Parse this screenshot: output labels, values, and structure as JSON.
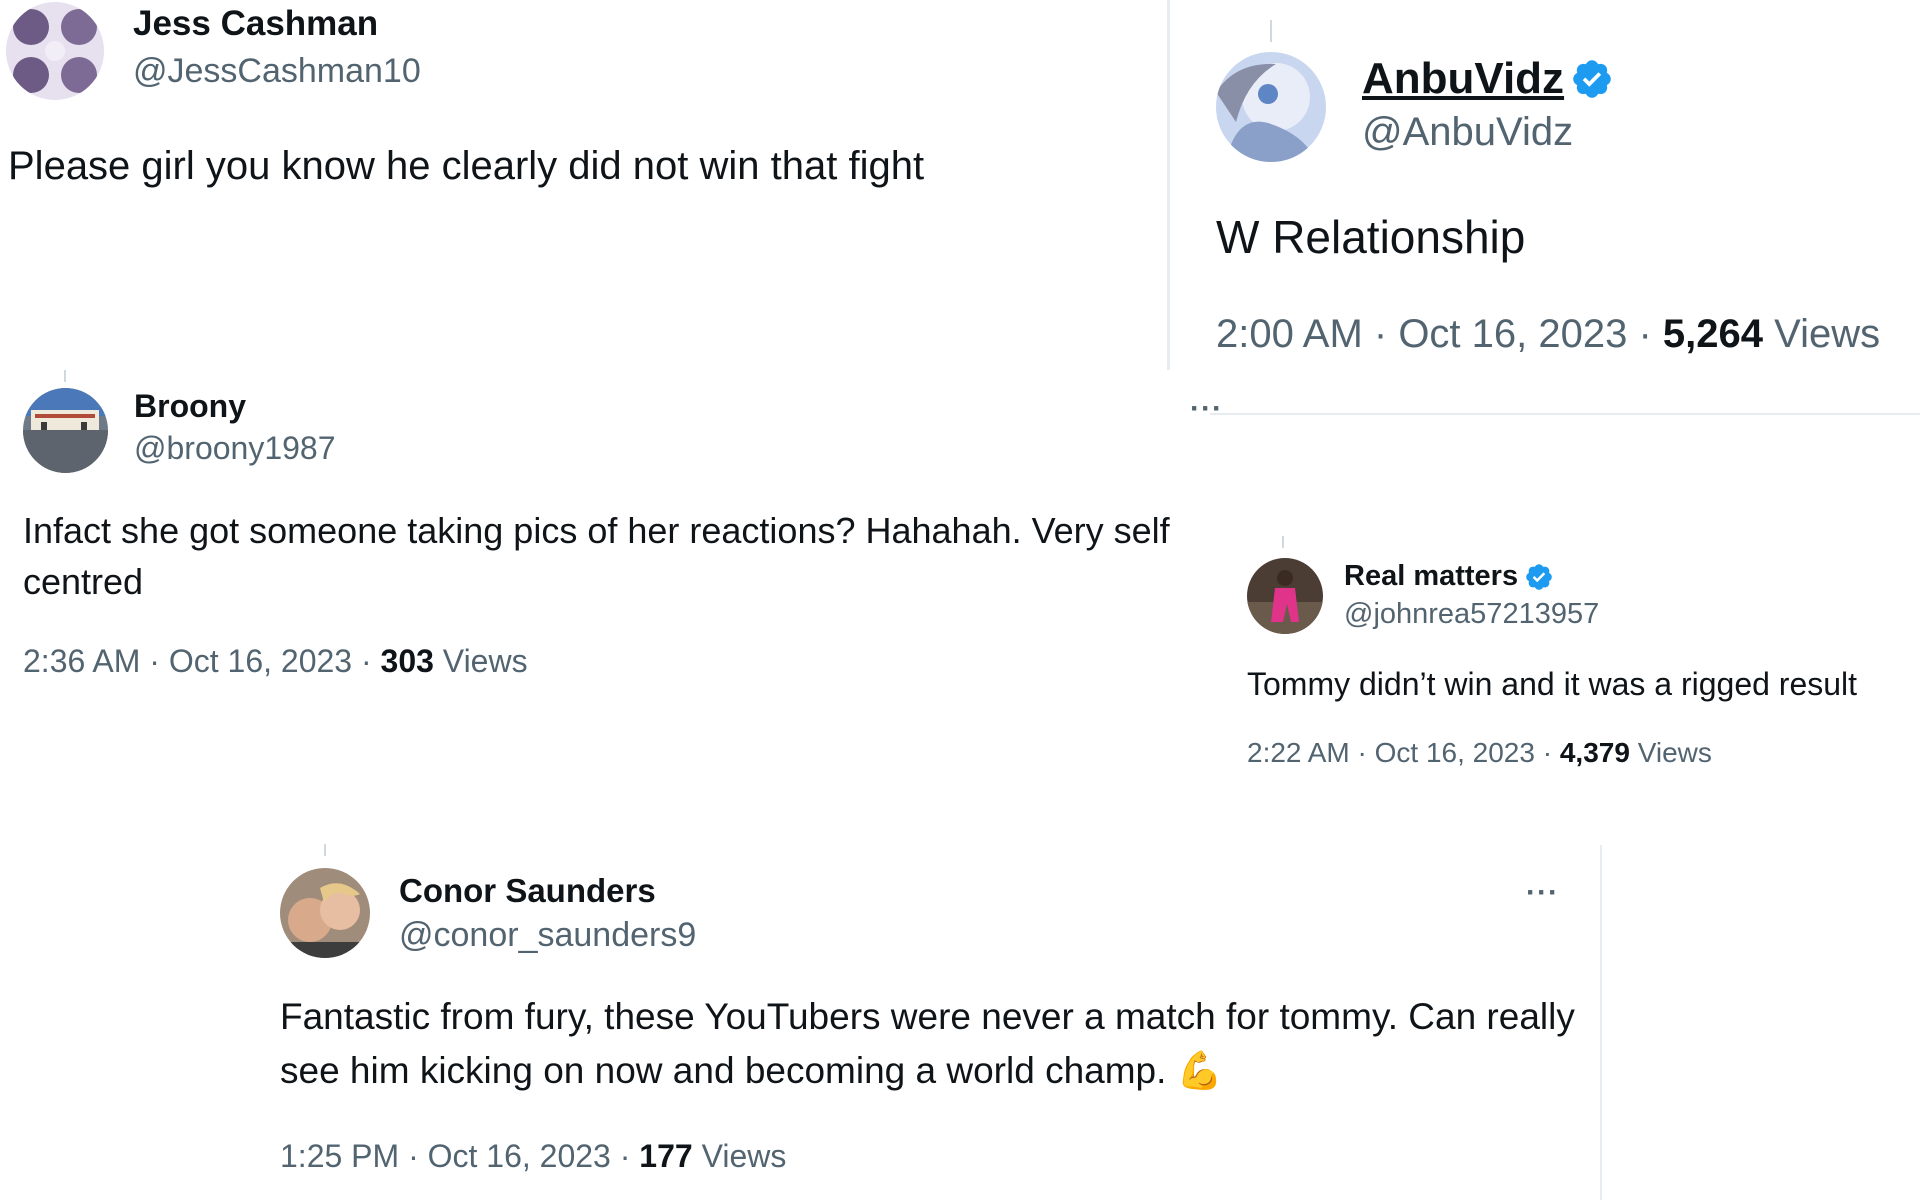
{
  "tweets": {
    "jess": {
      "name": "Jess Cashman",
      "handle": "@JessCashman10",
      "text": "Please girl you know he clearly did not win that fight"
    },
    "anbu": {
      "name": "AnbuVidz",
      "handle": "@AnbuVidz",
      "text": "W Relationship",
      "time": "2:00 AM",
      "date": "Oct 16, 2023",
      "views_count": "5,264",
      "views_label": "Views",
      "verified": true
    },
    "broony": {
      "name": "Broony",
      "handle": "@broony1987",
      "text": "Infact she got someone taking pics of her reactions? Hahahah. Very self centred",
      "time": "2:36 AM",
      "date": "Oct 16, 2023",
      "views_count": "303",
      "views_label": "Views",
      "more": "···"
    },
    "real": {
      "name": "Real matters",
      "handle": "@johnrea57213957",
      "text": "Tommy didn’t win and it was a rigged result",
      "time": "2:22 AM",
      "date": "Oct 16, 2023",
      "views_count": "4,379",
      "views_label": "Views",
      "verified": true
    },
    "conor": {
      "name": "Conor Saunders",
      "handle": "@conor_saunders9",
      "text": "Fantastic from fury, these YouTubers were never a match for tommy. Can really see him kicking on now and becoming a world champ.",
      "emoji": "💪",
      "time": "1:25 PM",
      "date": "Oct 16, 2023",
      "views_count": "177",
      "views_label": "Views",
      "more": "···"
    }
  },
  "separator": " · ",
  "colors": {
    "text": "#0f1419",
    "secondary": "#536471",
    "verified": "#1d9bf0",
    "divider": "#e6ecf0"
  },
  "icons": {
    "verified": "verified-badge-icon",
    "more": "more-options-icon",
    "flex": "flexed-biceps-emoji"
  }
}
